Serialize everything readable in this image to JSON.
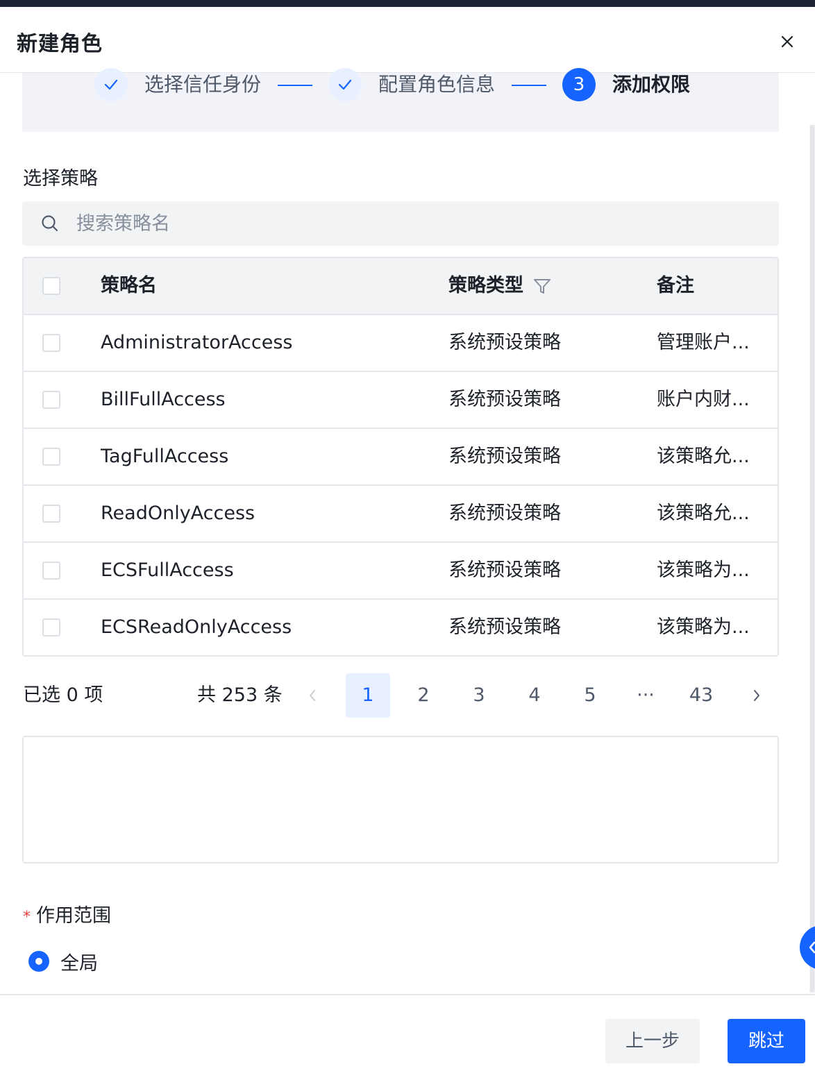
{
  "dialog": {
    "title": "新建角色"
  },
  "steps": [
    {
      "label": "选择信任身份",
      "state": "done"
    },
    {
      "label": "配置角色信息",
      "state": "done"
    },
    {
      "number": "3",
      "label": "添加权限",
      "state": "active"
    }
  ],
  "policy_section": {
    "title": "选择策略",
    "search_placeholder": "搜索策略名"
  },
  "table": {
    "columns": {
      "name": "策略名",
      "type": "策略类型",
      "note": "备注"
    },
    "rows": [
      {
        "name": "AdministratorAccess",
        "type": "系统预设策略",
        "note": "管理账户..."
      },
      {
        "name": "BillFullAccess",
        "type": "系统预设策略",
        "note": "账户内财..."
      },
      {
        "name": "TagFullAccess",
        "type": "系统预设策略",
        "note": "该策略允..."
      },
      {
        "name": "ReadOnlyAccess",
        "type": "系统预设策略",
        "note": "该策略允..."
      },
      {
        "name": "ECSFullAccess",
        "type": "系统预设策略",
        "note": "该策略为..."
      },
      {
        "name": "ECSReadOnlyAccess",
        "type": "系统预设策略",
        "note": "该策略为..."
      }
    ]
  },
  "pagination": {
    "selected": "已选 0 项",
    "total": "共 253 条",
    "pages": [
      "1",
      "2",
      "3",
      "4",
      "5",
      "···",
      "43"
    ],
    "current": "1"
  },
  "scope": {
    "label": "作用范围",
    "required_mark": "*",
    "option": "全局"
  },
  "footer": {
    "prev_label": "上一步",
    "skip_label": "跳过"
  },
  "colors": {
    "primary": "#1664ff",
    "required": "#f53f3f"
  }
}
